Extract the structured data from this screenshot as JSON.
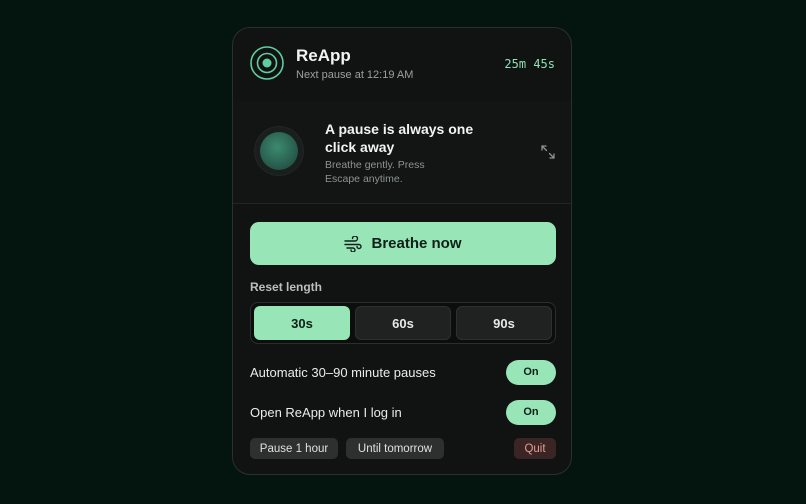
{
  "header": {
    "title": "ReApp",
    "subtitle": "Next pause at 12:19 AM",
    "timer": "25m 45s"
  },
  "preview": {
    "title": "A pause is always one click away",
    "subtitle": "Breathe gently. Press Escape anytime.",
    "expand_icon": "expand-icon"
  },
  "breathe": {
    "label": "Breathe now",
    "icon": "wind-icon"
  },
  "reset": {
    "label": "Reset length",
    "options": [
      "30s",
      "60s",
      "90s"
    ],
    "selected": "30s"
  },
  "toggles": [
    {
      "label": "Automatic 30–90 minute pauses",
      "state": "On"
    },
    {
      "label": "Open ReApp when I log in",
      "state": "On"
    }
  ],
  "footer": {
    "pause_hour": "Pause 1 hour",
    "until_tomorrow": "Until tomorrow",
    "quit": "Quit"
  },
  "colors": {
    "accent": "#98e5b8",
    "background": "#04140f",
    "panel": "#111312",
    "quit_text": "#e59a95"
  }
}
